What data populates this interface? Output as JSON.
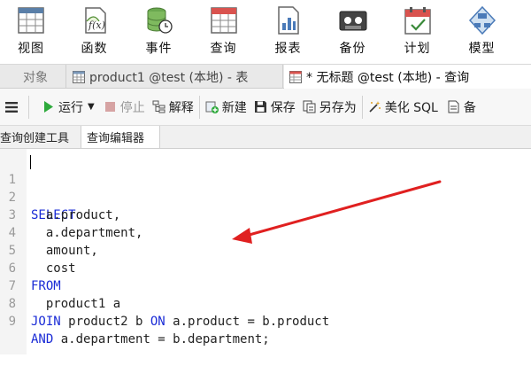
{
  "ribbon": {
    "items": [
      {
        "label": "视图",
        "icon": "table-grid-icon"
      },
      {
        "label": "函数",
        "icon": "function-fx-icon"
      },
      {
        "label": "事件",
        "icon": "database-clock-icon"
      },
      {
        "label": "查询",
        "icon": "query-table-icon"
      },
      {
        "label": "报表",
        "icon": "report-chart-icon"
      },
      {
        "label": "备份",
        "icon": "backup-tape-icon"
      },
      {
        "label": "计划",
        "icon": "calendar-check-icon"
      },
      {
        "label": "模型",
        "icon": "model-diagram-icon"
      }
    ]
  },
  "tabs": {
    "objects": "对象",
    "tab1": "product1 @test (本地) - 表",
    "tab2": "* 无标题 @test (本地) - 查询"
  },
  "toolbar": {
    "run": "运行",
    "stop": "停止",
    "explain": "解释",
    "new": "新建",
    "save": "保存",
    "save_as": "另存为",
    "beautify": "美化 SQL",
    "backup_cut": "备"
  },
  "subtabs": {
    "builder": "查询创建工具",
    "editor": "查询编辑器"
  },
  "editor": {
    "lines": [
      {
        "n": "1",
        "kw": "SELECT",
        "rest": ""
      },
      {
        "n": "2",
        "kw": "",
        "rest": "  a.product,"
      },
      {
        "n": "3",
        "kw": "",
        "rest": "  a.department,"
      },
      {
        "n": "4",
        "kw": "",
        "rest": "  amount,"
      },
      {
        "n": "5",
        "kw": "",
        "rest": "  cost"
      },
      {
        "n": "6",
        "kw": "FROM",
        "rest": ""
      },
      {
        "n": "7",
        "kw": "",
        "rest": "  product1 a"
      },
      {
        "n": "8",
        "kw": "JOIN",
        "rest": " product2 b ",
        "kw2": "ON",
        "rest2": " a.product = b.product"
      },
      {
        "n": "9",
        "kw": "AND",
        "rest": " a.department = b.department;"
      }
    ]
  },
  "colors": {
    "keyword": "#1a2bd6",
    "run_green": "#2eaa3c",
    "annotation_arrow": "#e02020"
  }
}
